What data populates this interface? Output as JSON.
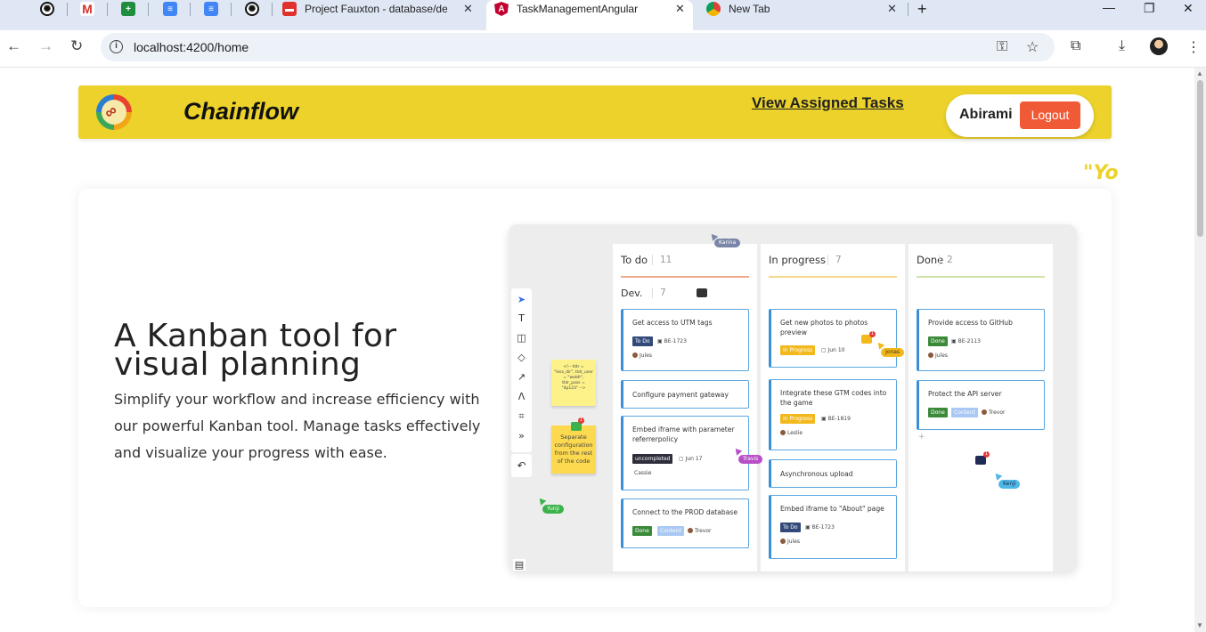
{
  "browser": {
    "tabs": [
      {
        "title": "",
        "favicon": "openai-icon"
      },
      {
        "title": "",
        "favicon": "gmail-icon"
      },
      {
        "title": "",
        "favicon": "sheets-icon"
      },
      {
        "title": "",
        "favicon": "docs-icon"
      },
      {
        "title": "",
        "favicon": "docs-icon"
      },
      {
        "title": "",
        "favicon": "openai-icon"
      },
      {
        "title": "Project Fauxton - database/dem",
        "favicon": "couchdb-icon"
      },
      {
        "title": "TaskManagementAngular",
        "favicon": "angular-icon",
        "active": true
      },
      {
        "title": "New Tab",
        "favicon": "chrome-icon"
      }
    ],
    "url": "localhost:4200/home"
  },
  "header": {
    "brand": "Chainflow",
    "view_link": "View Assigned Tasks",
    "user_name": "Abirami",
    "logout_label": "Logout",
    "color": "#ecd22b"
  },
  "marquee_text": "\"Yo",
  "hero": {
    "title": "A Kanban tool for visual planning",
    "description": "Simplify your workflow and increase efficiency with our powerful Kanban tool. Manage tasks effectively and visualize your progress with ease."
  },
  "board": {
    "columns": [
      {
        "name": "To do",
        "count": "11",
        "group": "Dev.",
        "group_count": "7"
      },
      {
        "name": "In progress",
        "count": "7"
      },
      {
        "name": "Done",
        "count": "2"
      }
    ],
    "todo_cards": [
      {
        "title": "Get access to UTM tags",
        "tag": "To Do",
        "ticket": "BE-1723",
        "user": "Jules"
      },
      {
        "title": "Configure payment gateway"
      },
      {
        "title": "Embed iframe with parameter referrerpolicy",
        "tag": "uncompleted",
        "date": "Jun 17",
        "user": "Cassie"
      },
      {
        "title": "Connect to the PROD database",
        "tag": "Done",
        "tag2": "Content",
        "user": "Trevor"
      }
    ],
    "progress_cards": [
      {
        "title": "Get new photos to photos preview",
        "tag": "In Progress",
        "date": "Jun 10"
      },
      {
        "title": "Integrate these GTM codes into the game",
        "tag": "In Progress",
        "ticket": "BE-1819",
        "user": "Leslie"
      },
      {
        "title": "Asynchronous upload"
      },
      {
        "title": "Embed iframe to \"About\" page",
        "tag": "To Do",
        "ticket": "BE-1723",
        "user": "Jules"
      }
    ],
    "done_cards": [
      {
        "title": "Provide access to GitHub",
        "tag": "Done",
        "ticket": "BE-2113",
        "user": "Jules"
      },
      {
        "title": "Protect the API server",
        "tag": "Done",
        "tag2": "Content",
        "user": "Trevor"
      }
    ],
    "cursors": {
      "karina": "Karina",
      "jonas": "Jonas",
      "travis": "Travis",
      "yunji": "Yunji",
      "kenji": "Kenji"
    },
    "stickies": {
      "code": "<!-- tldr = \"less_dir\", tldr_user = \"webfr\", tldr_pass = \"4p123\" -->",
      "note": "Separate configuration from the rest of the code"
    }
  }
}
